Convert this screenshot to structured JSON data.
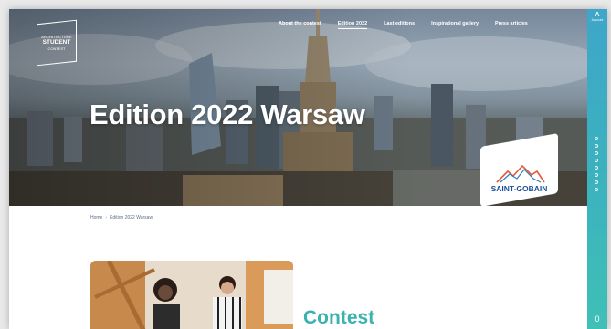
{
  "site": {
    "logo": {
      "line1": "ARCHITECTURE",
      "line2": "STUDENT",
      "line3": "CONTEST"
    }
  },
  "nav": {
    "items": [
      {
        "label": "About the contest"
      },
      {
        "label": "Edition 2022"
      },
      {
        "label": "Last editions"
      },
      {
        "label": "Inspirational gallery"
      },
      {
        "label": "Press articles"
      }
    ],
    "active_index": 1
  },
  "hero": {
    "title": "Edition 2022 Warsaw",
    "sponsor": "SAINT-GOBAIN"
  },
  "rail": {
    "account_letter": "A",
    "account_label": "Account",
    "counter": "0"
  },
  "breadcrumb": {
    "home": "Home",
    "current": "Edition 2022 Warsaw"
  },
  "content": {
    "section_heading": "Contest"
  },
  "colors": {
    "accent": "#3bb1b0",
    "rail": "#3fa6c9",
    "sponsor_blue": "#1c4f9c"
  }
}
